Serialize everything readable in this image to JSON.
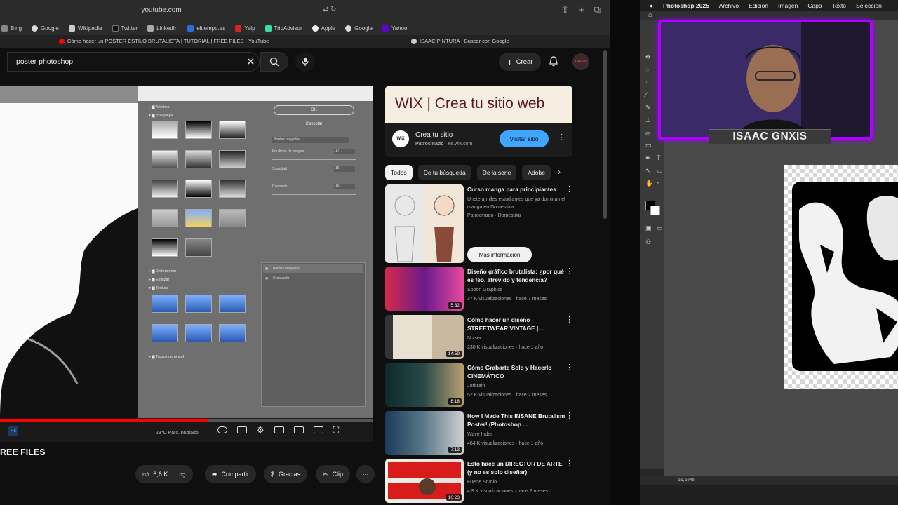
{
  "safari": {
    "url": "youtube.com",
    "favorites": [
      "Bing",
      "Google",
      "Wikipedia",
      "Twitter",
      "LinkedIn",
      "eltiempo.es",
      "Yelp",
      "TripAdvisor",
      "Apple",
      "Google",
      "Yahoo"
    ],
    "tabs": [
      {
        "title": "Cómo hacer un POSTER ESTILO BRUTALISTA | TUTORIAL | FREE FILES - YouTube",
        "icon_color": "#ff0000"
      },
      {
        "title": "ISAAC PINTURA - Buscar con Google",
        "icon_color": "#cccccc"
      }
    ]
  },
  "youtube": {
    "search_value": "poster photoshop",
    "crear_label": "Crear",
    "avatar_text": "GNXIS",
    "video": {
      "title_fragment": "REE FILES",
      "progress": 0.56,
      "taskbar_weather": "23°C  Parc. nublado",
      "actions": {
        "likes": "6,6 K",
        "share": "Compartir",
        "thanks": "Gracias",
        "clip": "Clip"
      }
    },
    "player_dialog": {
      "ok": "OK",
      "cancel": "Cancelar",
      "groups": [
        "Artístico",
        "Bosquejar",
        "Distorsionar",
        "Estilizar",
        "Textura",
        "Trazos de pincel"
      ],
      "filter_select": "Bordes rasgados",
      "sliders": [
        {
          "label": "Equilibrio de imagen",
          "value": "17"
        },
        {
          "label": "Suavidad",
          "value": "15"
        },
        {
          "label": "Contraste",
          "value": "16"
        }
      ],
      "effects": [
        "Bordes rasgados",
        "Granulado"
      ]
    },
    "ad": {
      "banner": "WIX | Crea tu sitio web",
      "logo": "WIX",
      "title": "Crea tu sitio",
      "sponsor": "Patrocinado",
      "domain": "es.wix.com",
      "cta": "Visitar sitio"
    },
    "chips": [
      "Todos",
      "De tu búsqueda",
      "De la serie",
      "Adobe"
    ],
    "recommendations": [
      {
        "title": "Curso manga para principiantes",
        "desc": "Únete a miles estudiantes que ya dominan el manga en Domestika",
        "channel": "Patrocinado · Domestika",
        "cta": "Más información"
      },
      {
        "title": "Diseño gráfico brutalista: ¿por qué es feo, atrevido y tendencia?",
        "channel": "Spoon Graphics",
        "meta": "37 K visualizaciones · hace 7 meses",
        "duration": "5:32"
      },
      {
        "title": "Cómo hacer un diseño STREETWEAR VINTAGE | ...",
        "channel": "Noiser",
        "meta": "230 K visualizaciones · hace 1 año",
        "duration": "14:59"
      },
      {
        "title": "Cómo Grabarte Solo y Hacerlo CINEMÁTICO",
        "channel": "Jorbrain",
        "meta": "52 K visualizaciones · hace 2 meses",
        "duration": "8:18"
      },
      {
        "title": "How I Made This INSANE Brutalism Poster! (Photoshop ...",
        "channel": "Wave Inder",
        "meta": "484 K visualizaciones · hace 1 año",
        "duration": "7:13"
      },
      {
        "title": "Esto hace un DIRECTOR DE ARTE (y no es solo diseñar)",
        "channel": "Fuerte Studio",
        "meta": "4,9 K visualizaciones · hace 2 meses",
        "duration": "10:23"
      }
    ]
  },
  "photoshop": {
    "menu": [
      "Photoshop 2025",
      "Archivo",
      "Edición",
      "Imagen",
      "Capa",
      "Texto",
      "Selección"
    ],
    "zoom": "66,67%"
  },
  "webcam": {
    "name": "ISAAC GNXIS",
    "border_color": "#b100ff"
  }
}
